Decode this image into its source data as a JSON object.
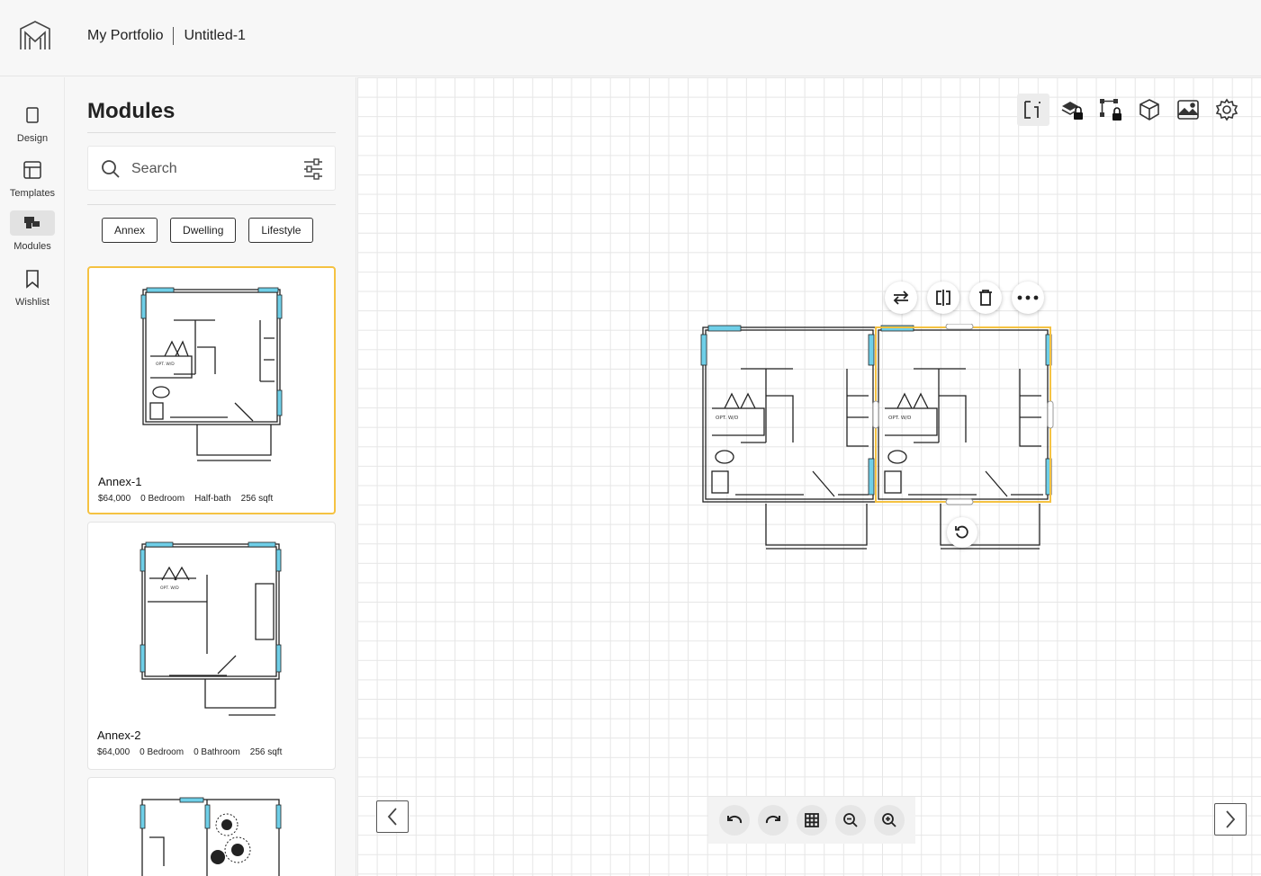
{
  "header": {
    "portfolio_link": "My Portfolio",
    "project_name": "Untitled-1",
    "logo_icon": "m-logo-icon"
  },
  "rail": {
    "items": [
      {
        "label": "Design",
        "icon": "page-icon",
        "active": false
      },
      {
        "label": "Templates",
        "icon": "layout-icon",
        "active": false
      },
      {
        "label": "Modules",
        "icon": "modules-icon",
        "active": true
      },
      {
        "label": "Wishlist",
        "icon": "bookmark-icon",
        "active": false
      }
    ]
  },
  "panel": {
    "title": "Modules",
    "search": {
      "placeholder": "Search",
      "value": ""
    },
    "filters": [
      "Annex",
      "Dwelling",
      "Lifestyle"
    ],
    "cards": [
      {
        "name": "Annex-1",
        "price": "$64,000",
        "bedrooms": "0 Bedroom",
        "baths": "Half-bath",
        "area": "256 sqft",
        "selected": true
      },
      {
        "name": "Annex-2",
        "price": "$64,000",
        "bedrooms": "0 Bedroom",
        "baths": "0 Bathroom",
        "area": "256 sqft",
        "selected": false
      },
      {
        "name": "",
        "price": "",
        "bedrooms": "",
        "baths": "",
        "area": "",
        "selected": false
      }
    ]
  },
  "canvas": {
    "toolbar": [
      "dimensions-icon",
      "layer-lock-icon",
      "node-lock-icon",
      "3d-view-icon",
      "image-icon",
      "settings-icon"
    ],
    "selection_tools": [
      "swap-icon",
      "mirror-icon",
      "trash-icon",
      "more-icon"
    ],
    "bottom_tools": [
      "undo-icon",
      "redo-icon",
      "grid-icon",
      "zoom-out-icon",
      "zoom-in-icon"
    ],
    "plan_labels": {
      "washer_dryer": "OPT. W/D"
    }
  },
  "colors": {
    "accent_selected": "#f5c242",
    "window_blue": "#6fcfe8",
    "text": "#222222"
  }
}
